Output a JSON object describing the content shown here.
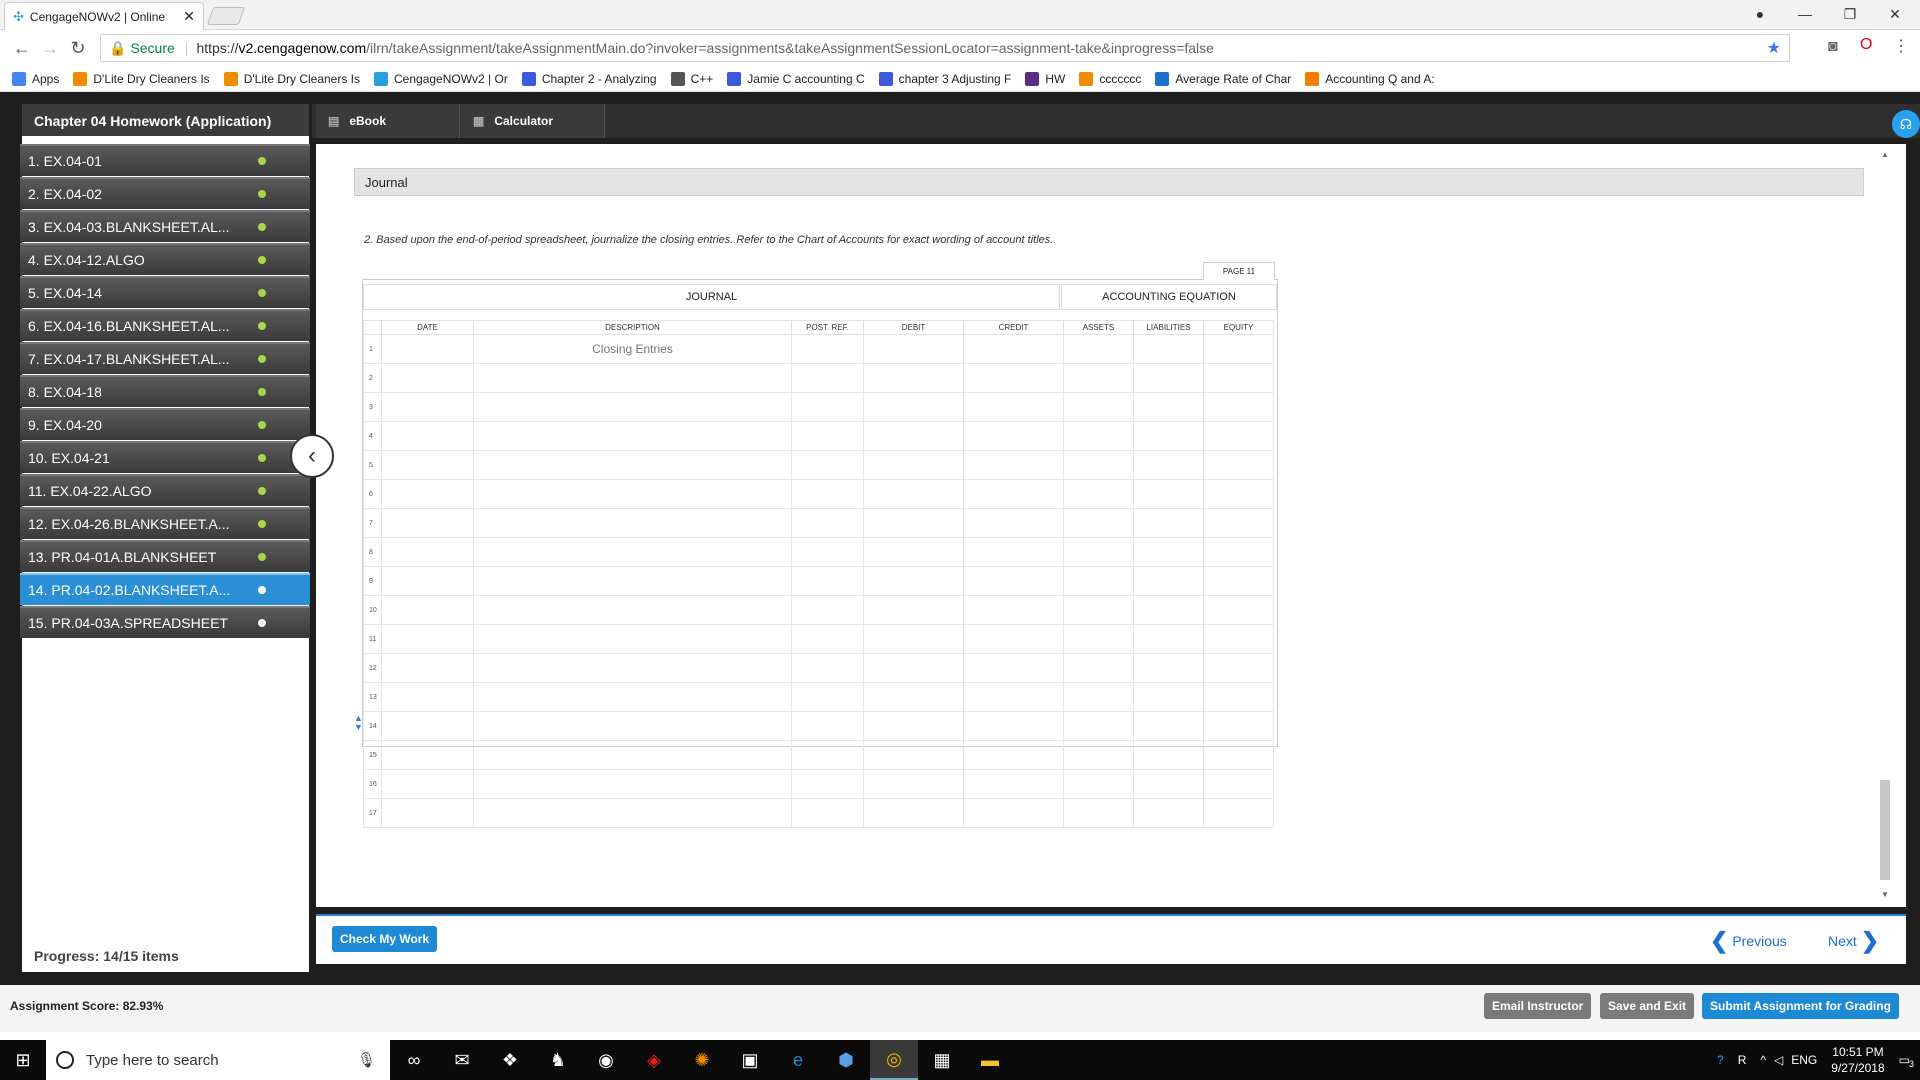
{
  "browser": {
    "tab_title": "CengageNOWv2 | Online",
    "secure_label": "Secure",
    "url_scheme": "https://",
    "url_host": "v2.cengagenow.com",
    "url_path": "/ilrn/takeAssignment/takeAssignmentMain.do?invoker=assignments&takeAssignmentSessionLocator=assignment-take&inprogress=false",
    "bookmarks": [
      {
        "label": "Apps",
        "icon": "apps-grid-icon",
        "color": "#4285f4"
      },
      {
        "label": "D'Lite Dry Cleaners Is",
        "icon": "cengage-c-icon",
        "color": "#f08c00"
      },
      {
        "label": "D'Lite Dry Cleaners Is",
        "icon": "cengage-c-icon",
        "color": "#f08c00"
      },
      {
        "label": "CengageNOWv2 | Or",
        "icon": "cengage-icon",
        "color": "#2aa0d8"
      },
      {
        "label": "Chapter 2 - Analyzing",
        "icon": "search-q-icon",
        "color": "#3b5bdb"
      },
      {
        "label": "C++",
        "icon": "gear-icon",
        "color": "#555555"
      },
      {
        "label": "Jamie C accounting C",
        "icon": "search-q-icon",
        "color": "#3b5bdb"
      },
      {
        "label": "chapter 3 Adjusting F",
        "icon": "search-q-icon",
        "color": "#3b5bdb"
      },
      {
        "label": "HW",
        "icon": "play-icon",
        "color": "#5a2d82"
      },
      {
        "label": "ccccccc",
        "icon": "cengage-c-icon",
        "color": "#f08c00"
      },
      {
        "label": "Average Rate of Char",
        "icon": "calendar-icon",
        "color": "#1e6fd0"
      },
      {
        "label": "Accounting Q and A:",
        "icon": "blogger-icon",
        "color": "#f57d00"
      }
    ]
  },
  "assignment": {
    "title": "Chapter 04 Homework (Application)",
    "tools": [
      "eBook",
      "Calculator"
    ],
    "items": [
      {
        "label": "1. EX.04-01",
        "status": "done"
      },
      {
        "label": "2. EX.04-02",
        "status": "done"
      },
      {
        "label": "3. EX.04-03.BLANKSHEET.AL...",
        "status": "done"
      },
      {
        "label": "4. EX.04-12.ALGO",
        "status": "done"
      },
      {
        "label": "5. EX.04-14",
        "status": "done"
      },
      {
        "label": "6. EX.04-16.BLANKSHEET.AL...",
        "status": "done"
      },
      {
        "label": "7. EX.04-17.BLANKSHEET.AL...",
        "status": "done"
      },
      {
        "label": "8. EX.04-18",
        "status": "done"
      },
      {
        "label": "9. EX.04-20",
        "status": "done"
      },
      {
        "label": "10. EX.04-21",
        "status": "done"
      },
      {
        "label": "11. EX.04-22.ALGO",
        "status": "done"
      },
      {
        "label": "12. EX.04-26.BLANKSHEET.A...",
        "status": "done"
      },
      {
        "label": "13. PR.04-01A.BLANKSHEET",
        "status": "done"
      },
      {
        "label": "14. PR.04-02.BLANKSHEET.A...",
        "status": "current"
      },
      {
        "label": "15. PR.04-03A.SPREADSHEET",
        "status": "open"
      }
    ],
    "progress": "Progress:  14/15 items",
    "score": "Assignment Score: 82.93%"
  },
  "journal": {
    "header": "Journal",
    "instructions": "2. Based upon the end-of-period spreadsheet, journalize the closing entries. Refer to the Chart of Accounts for exact wording of account titles.",
    "page": "PAGE 11",
    "section_journal": "JOURNAL",
    "section_equation": "ACCOUNTING EQUATION",
    "columns": [
      "DATE",
      "DESCRIPTION",
      "POST. REF.",
      "DEBIT",
      "CREDIT",
      "ASSETS",
      "LIABILITIES",
      "EQUITY"
    ],
    "row_numbers": [
      "1",
      "2",
      "3",
      "4",
      "5",
      "6",
      "7",
      "8",
      "9",
      "10",
      "11",
      "12",
      "13",
      "14",
      "15",
      "16",
      "17"
    ],
    "row1_description": "Closing Entries"
  },
  "buttons": {
    "check_my_work": "Check My Work",
    "previous": "Previous",
    "next": "Next",
    "email_instructor": "Email Instructor",
    "save_and_exit": "Save and Exit",
    "submit": "Submit Assignment for Grading"
  },
  "taskbar": {
    "search_placeholder": "Type here to search",
    "language": "ENG",
    "time": "10:51 PM",
    "date": "9/27/2018",
    "notifications": "3"
  },
  "colors": {
    "accent": "#2a8fd4",
    "done_dot": "#a6d84a",
    "submit": "#1e8ad6"
  }
}
